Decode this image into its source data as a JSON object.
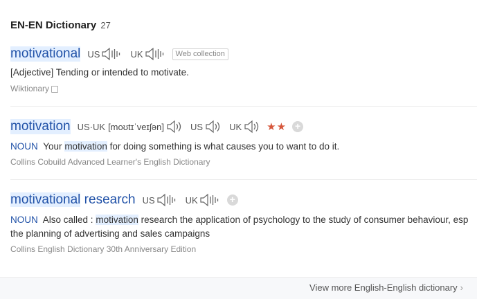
{
  "header": {
    "title": "EN-EN Dictionary",
    "count": "27"
  },
  "entries": [
    {
      "word": "motivational",
      "us_label": "US",
      "uk_label": "UK",
      "badge": "Web collection",
      "definition": "[Adjective] Tending or intended to motivate.",
      "source": "Wiktionary"
    },
    {
      "word": "motivation",
      "phonetic_label": "US·UK",
      "phonetic": "[moʊtɪˈveɪʃən]",
      "us_label": "US",
      "uk_label": "UK",
      "stars": "★★",
      "pos": "NOUN",
      "def_before": "Your",
      "def_highlight": "motivation",
      "def_after": "for doing something is what causes you to want to do it.",
      "source": "Collins Cobuild Advanced Learner's English Dictionary"
    },
    {
      "word_highlight": "motivational",
      "word_rest": "research",
      "us_label": "US",
      "uk_label": "UK",
      "pos": "NOUN",
      "def_before": "Also called :",
      "def_highlight": "motivation",
      "def_after": "research the application of psychology to the study of consumer behaviour, esp the planning of advertising and sales campaigns",
      "source": "Collins English Dictionary 30th Anniversary Edition"
    }
  ],
  "footer": {
    "view_more": "View more English-English dictionary"
  },
  "colors": {
    "link": "#2152a8",
    "highlight": "#e3efff",
    "stars": "#d6563b"
  },
  "icons": [
    "speaker-icon",
    "plus-icon",
    "chevron-right-icon",
    "checkbox-icon"
  ]
}
